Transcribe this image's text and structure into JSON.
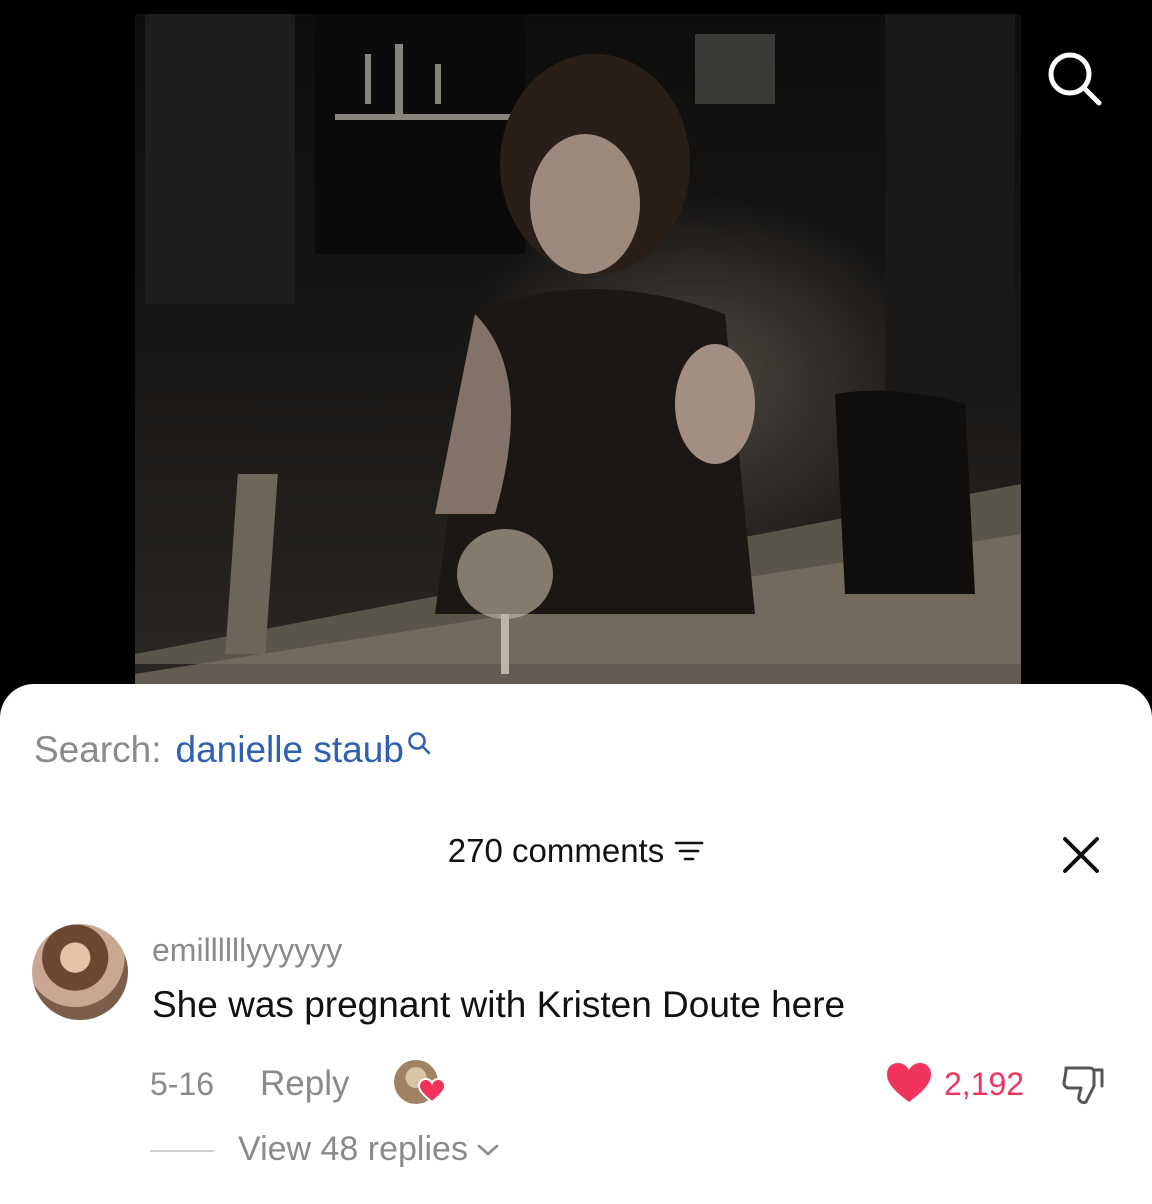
{
  "video": {
    "search_icon": "search-icon"
  },
  "search": {
    "label": "Search:",
    "query": "danielle staub",
    "icon": "search-icon"
  },
  "comments": {
    "count_label": "270 comments",
    "filter_icon": "filter-icon",
    "close_icon": "close-icon"
  },
  "comment": {
    "username": "emillllllyyyyyy",
    "text": "She was pregnant with Kristen Doute here",
    "date": "5-16",
    "reply_label": "Reply",
    "likes": "2,192",
    "view_replies_label": "View 48 replies"
  },
  "colors": {
    "link_blue": "#2d5fb3",
    "like_red": "#f2345d",
    "muted_gray": "#8a8a8a"
  }
}
